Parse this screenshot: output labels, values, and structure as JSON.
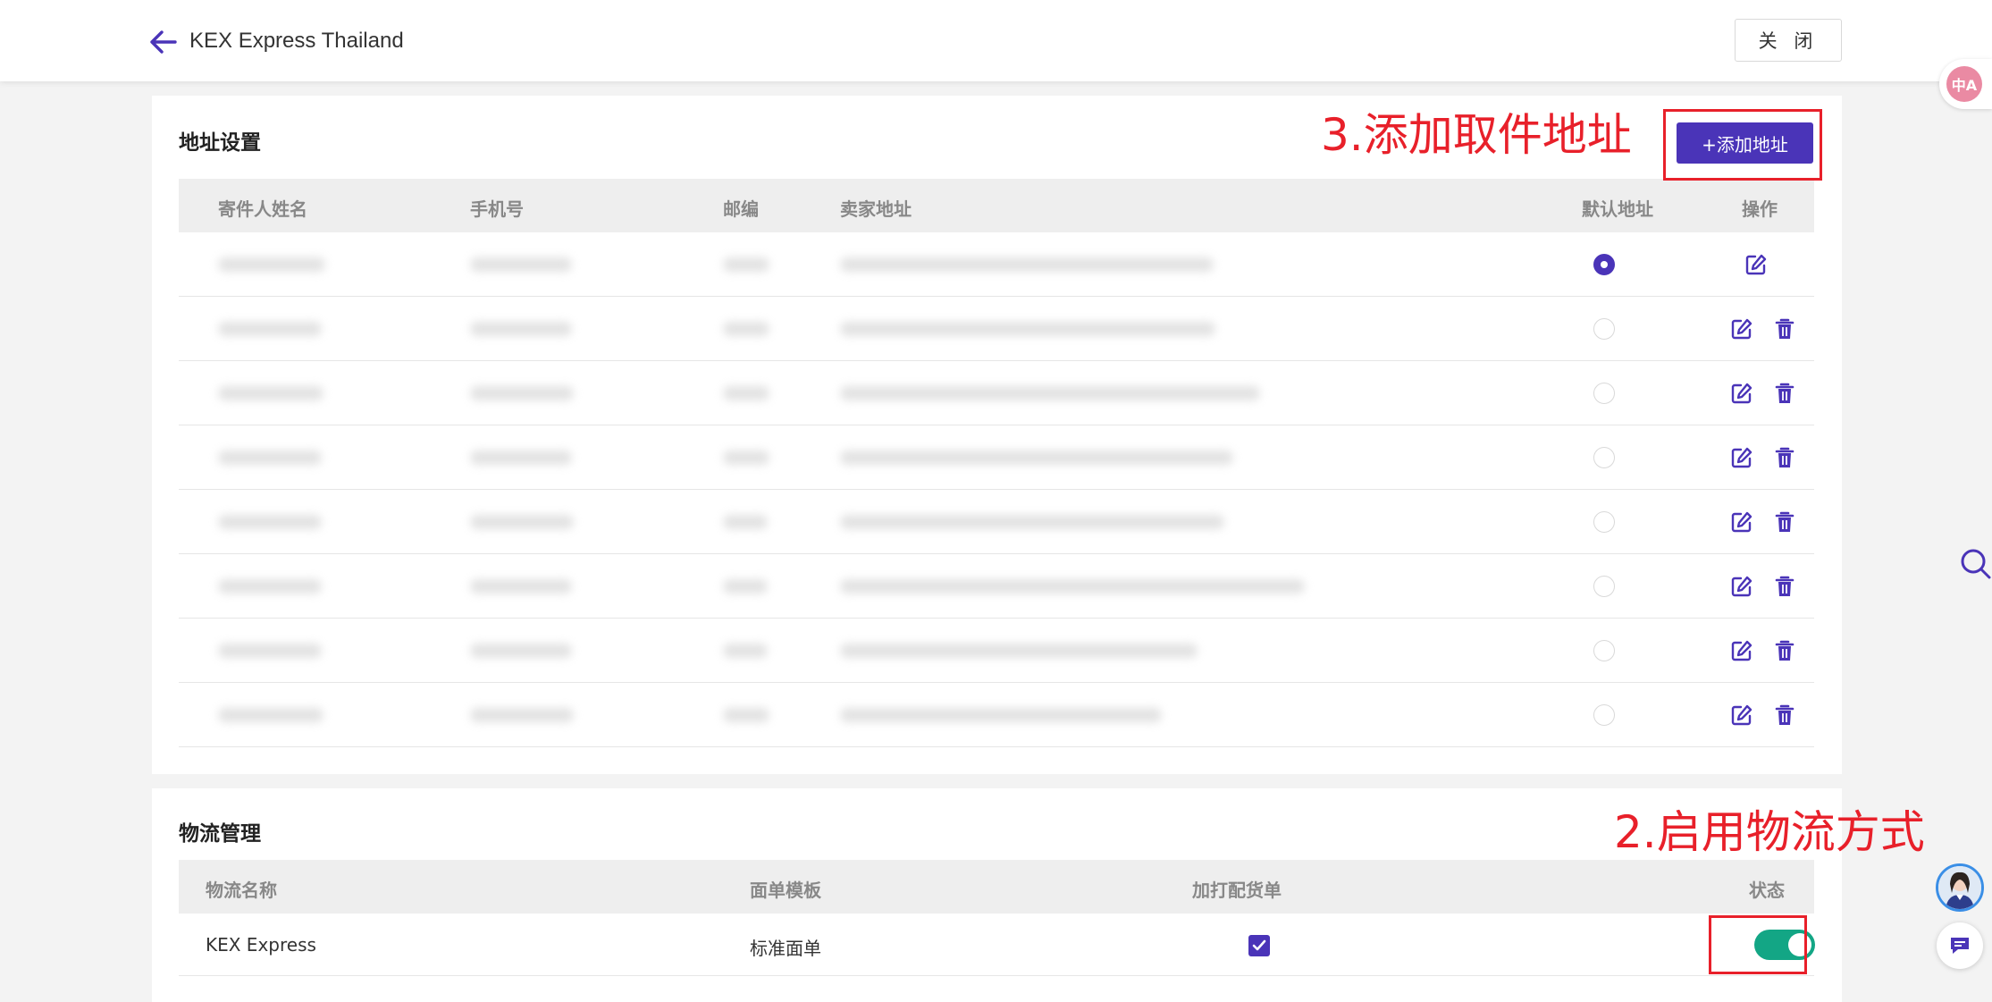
{
  "header": {
    "title": "KEX Express Thailand",
    "close_label": "关 闭"
  },
  "address": {
    "section_title": "地址设置",
    "add_button_label": "+添加地址",
    "columns": [
      "寄件人姓名",
      "手机号",
      "邮编",
      "卖家地址",
      "默认地址",
      "操作"
    ],
    "rows": [
      {
        "default": true,
        "deletable": false
      },
      {
        "default": false,
        "deletable": true
      },
      {
        "default": false,
        "deletable": true
      },
      {
        "default": false,
        "deletable": true
      },
      {
        "default": false,
        "deletable": true
      },
      {
        "default": false,
        "deletable": true
      },
      {
        "default": false,
        "deletable": true
      },
      {
        "default": false,
        "deletable": true
      }
    ]
  },
  "logistics": {
    "section_title": "物流管理",
    "columns": [
      "物流名称",
      "面单模板",
      "加打配货单",
      "状态"
    ],
    "rows": [
      {
        "name": "KEX Express",
        "template": "标准面单",
        "print_packing_list": true,
        "enabled": true
      }
    ]
  },
  "annotations": {
    "step3": "3.添加取件地址",
    "step2": "2.启用物流方式"
  },
  "floating": {
    "translate_glyph": "中A"
  },
  "colors": {
    "accent": "#4a34b8",
    "toggle_on": "#13a685",
    "annotation": "#e8202a"
  }
}
